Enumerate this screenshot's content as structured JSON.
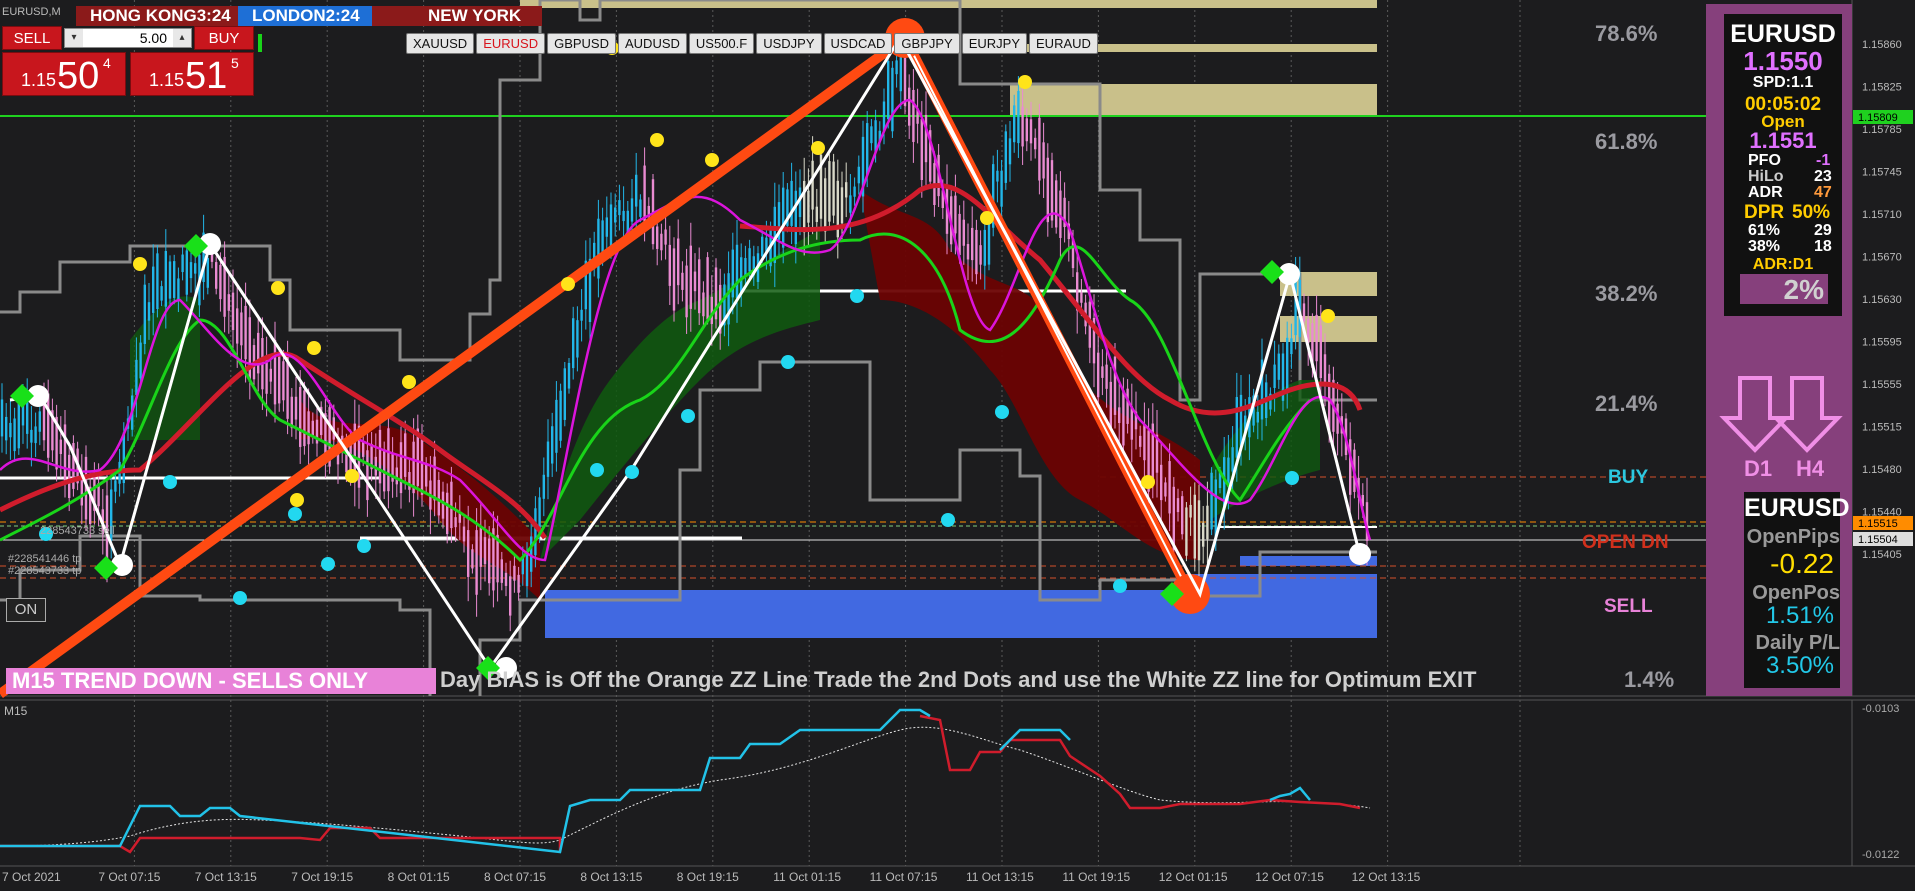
{
  "symbol_id": "EURUSD,M",
  "sessions": [
    {
      "name": "HONG KONG",
      "time": "3:24",
      "label": "HONG KONG3:24",
      "color": "#8b1a1a"
    },
    {
      "name": "LONDON",
      "time": "2:24",
      "label": "LONDON2:24",
      "color": "#1e6fd6"
    },
    {
      "name": "NEW YORK",
      "label": "NEW YORK",
      "color": "#8b1a1a"
    }
  ],
  "trade_panel": {
    "sell_label": "SELL",
    "buy_label": "BUY",
    "lot_value": "5.00",
    "lot_down": "▾",
    "lot_up": "▴",
    "sell_prefix": "1.15",
    "sell_big": "50",
    "sell_sup": "4",
    "buy_prefix": "1.15",
    "buy_big": "51",
    "buy_sup": "5"
  },
  "symbol_tabs": [
    "XAUUSD",
    "EURUSD",
    "GBPUSD",
    "AUDUSD",
    "US500.F",
    "USDJPY",
    "USDCAD",
    "GBPJPY",
    "EURJPY",
    "EURAUD"
  ],
  "active_tab": "EURUSD",
  "fib_levels": [
    "78.6%",
    "61.8%",
    "38.2%",
    "21.4%",
    "1.4%"
  ],
  "zone_labels": {
    "buy": "BUY",
    "open": "OPEN DN",
    "sell": "SELL"
  },
  "price_axis": [
    "1.15860",
    "1.15825",
    "1.15785",
    "1.15745",
    "1.15710",
    "1.15670",
    "1.15630",
    "1.15595",
    "1.15555",
    "1.15515",
    "1.15480",
    "1.15440",
    "1.15405"
  ],
  "price_markers": [
    {
      "label": "1.15809",
      "color": "#1fd11f"
    },
    {
      "label": "1.15515",
      "color": "#ff8c00"
    },
    {
      "label": "1.15504",
      "color": "#dddddd"
    }
  ],
  "sub_axis": [
    "-0.0103",
    "-0.0122"
  ],
  "sub_label": "M15",
  "time_axis": [
    "7 Oct 2021",
    "7 Oct 07:15",
    "7 Oct 13:15",
    "7 Oct 19:15",
    "8 Oct 01:15",
    "8 Oct 07:15",
    "8 Oct 13:15",
    "8 Oct 19:15",
    "11 Oct 01:15",
    "11 Oct 07:15",
    "11 Oct 13:15",
    "11 Oct 19:15",
    "12 Oct 01:15",
    "12 Oct 07:15",
    "12 Oct 13:15"
  ],
  "order_lines": [
    "#228541446 tp",
    "#228543733 tp",
    "228543733 sell"
  ],
  "on_button": "ON",
  "banner": {
    "left": "M15  TREND DOWN - SELLS ONLY",
    "mid1": "Day BIAS is Off the Orange ZZ Line",
    "mid2": "Trade the 2nd Dots and use the White ZZ line for Optimum EXIT"
  },
  "info_panel": {
    "symbol": "EURUSD",
    "price": "1.1550",
    "spread": "SPD:1.1",
    "timer": "00:05:02",
    "open_label": "Open",
    "open_price": "1.1551",
    "rows": [
      {
        "k": "PFO",
        "v": "-1",
        "vc": "#e070ff"
      },
      {
        "k": "HiLo",
        "v": "23",
        "vc": "#ffffff"
      },
      {
        "k": "ADR",
        "v": "47",
        "vc": "#ff9a3c"
      },
      {
        "k": "61%",
        "v": "29",
        "vc": "#ffffff"
      },
      {
        "k": "38%",
        "v": "18",
        "vc": "#ffffff"
      }
    ],
    "dpr_label": "DPR",
    "dpr_value": "50%",
    "adr_tf": "ADR:D1",
    "pct": "2%"
  },
  "bias": {
    "d1": "D1",
    "h4": "H4"
  },
  "pips_panel": {
    "symbol": "EURUSD",
    "open_pips_label": "OpenPips",
    "open_pips": "-0.22",
    "open_pos_label": "OpenPos",
    "open_pos": "1.51%",
    "daily_label": "Daily P/L",
    "daily": "3.50%"
  },
  "colors": {
    "bg": "#1c1c1e",
    "bull": "#22b6e8",
    "bear": "#e98bd1",
    "doji": "#d8d8c8",
    "orange_zz": "#ff4a12",
    "white_zz": "#ffffff",
    "green_ma": "#19d419",
    "red_ma": "#d01c2c",
    "magenta_ma": "#dc14dc",
    "channel": "#8a8a8a",
    "supply": "#c9c08a",
    "demand": "#4169e1"
  }
}
